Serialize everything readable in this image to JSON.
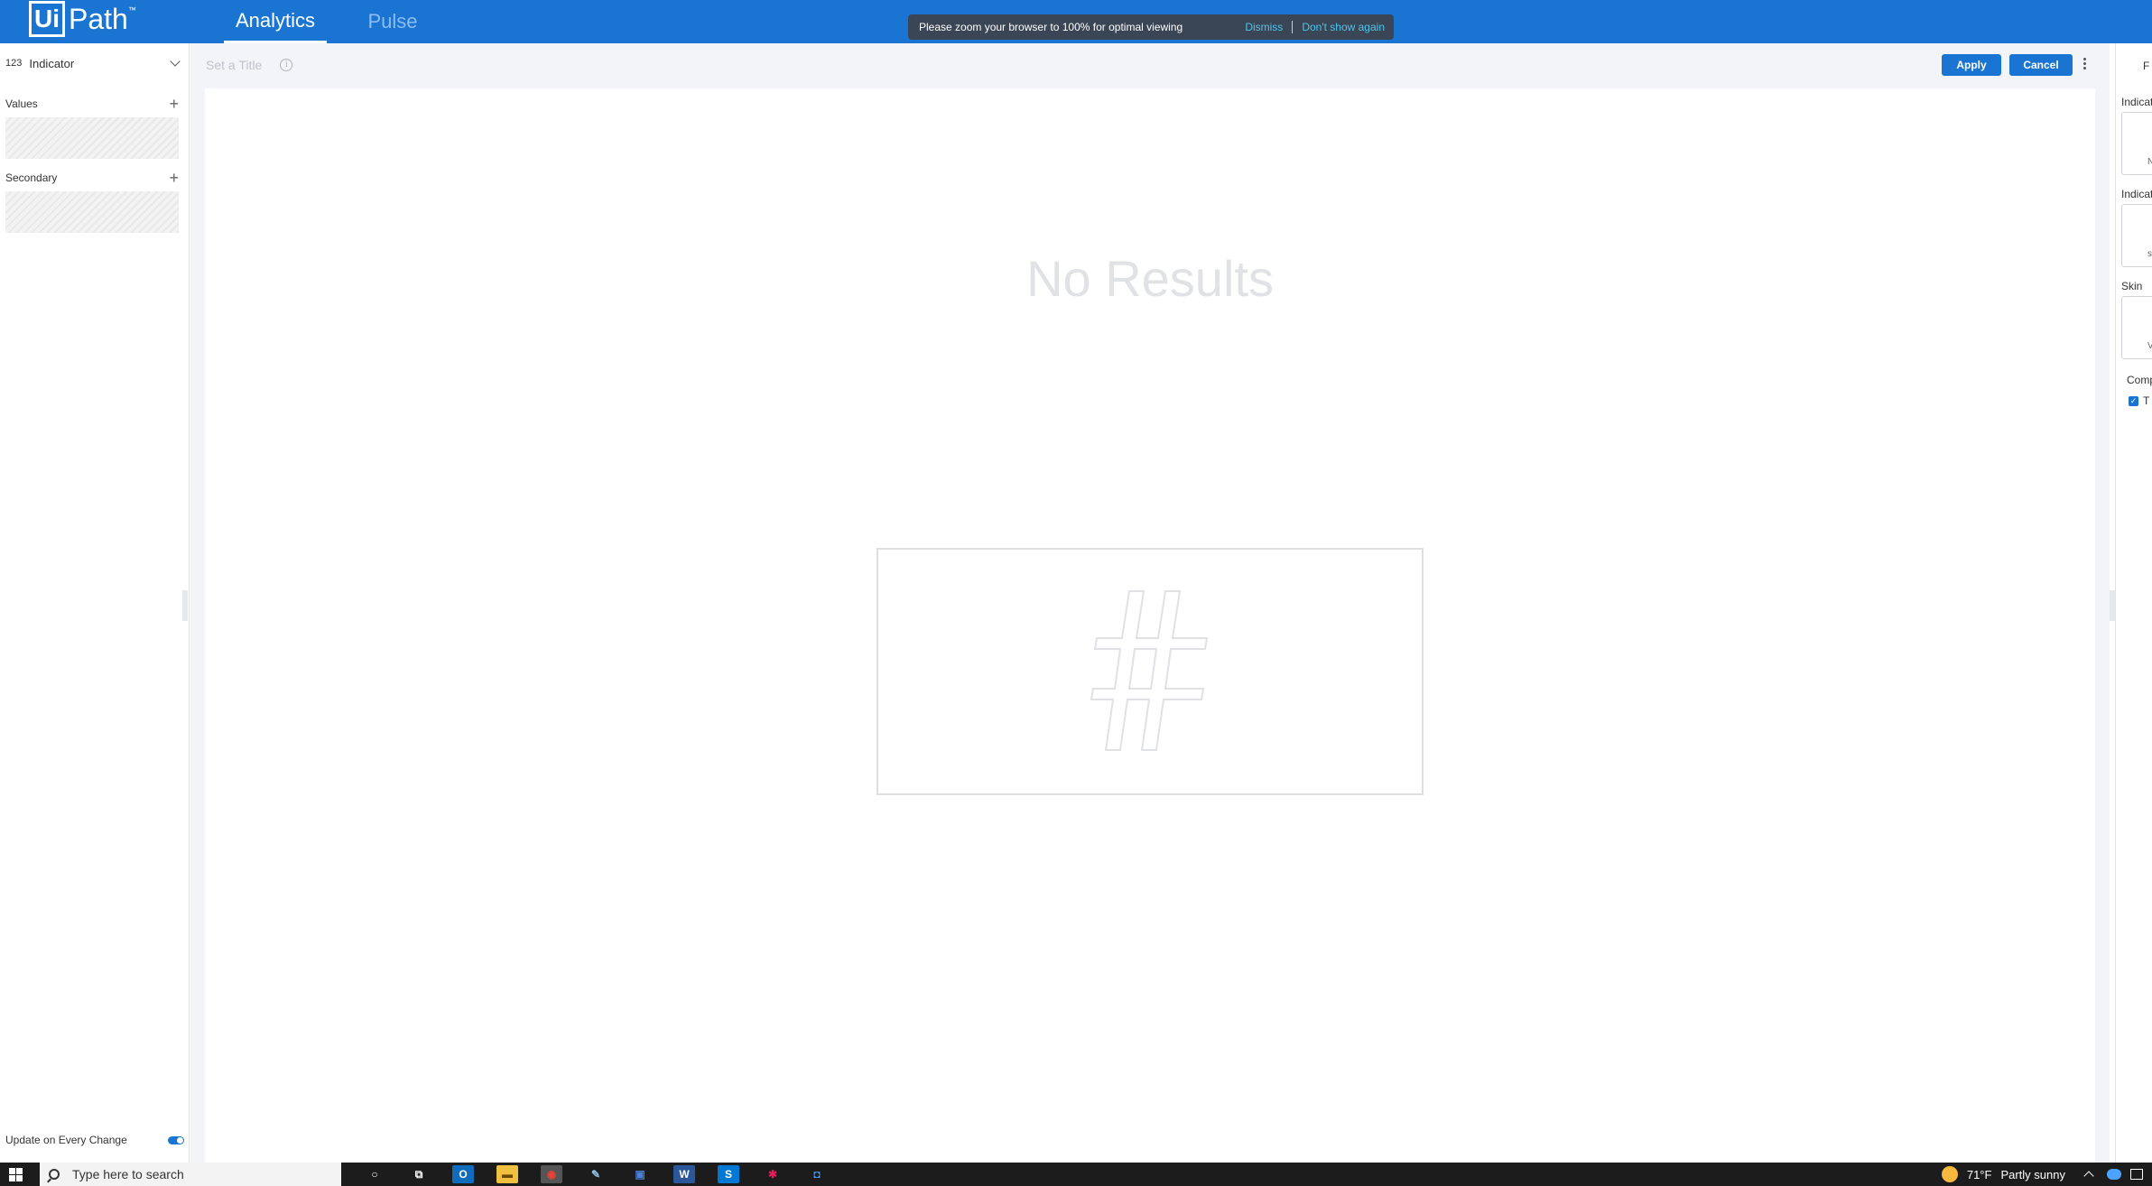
{
  "header": {
    "logo_mark": "Ui",
    "logo_text": "Path",
    "logo_tm": "™",
    "tabs": [
      {
        "label": "Analytics",
        "active": true
      },
      {
        "label": "Pulse",
        "active": false
      }
    ],
    "zoom_notice": {
      "message": "Please zoom your browser to 100% for optimal viewing",
      "dismiss": "Dismiss",
      "dont_show": "Don't show again"
    },
    "colors": {
      "bar": "#1a75d2",
      "accent": "#4fc3e9"
    }
  },
  "left_panel": {
    "viz_type_icon": "123",
    "viz_type": "Indicator",
    "sections": [
      {
        "title": "Values",
        "add_icon": "+"
      },
      {
        "title": "Secondary",
        "add_icon": "+"
      }
    ],
    "update_label": "Update on Every Change",
    "update_toggle_on": true
  },
  "toolbar": {
    "title_placeholder": "Set a Title",
    "info_icon": "i",
    "apply_label": "Apply",
    "cancel_label": "Cancel"
  },
  "canvas": {
    "no_results": "No Results",
    "placeholder_icon": "hash-icon"
  },
  "right_panel": {
    "top_label": "F",
    "labels": [
      "Indicat",
      "Indicat",
      "Skin",
      "Comp"
    ],
    "box_values": [
      "N",
      "s",
      "V"
    ],
    "checkbox_label": "T",
    "checkbox_checked": true
  },
  "taskbar": {
    "search_placeholder": "Type here to search",
    "weather_temp": "71°F",
    "weather_text": "Partly sunny",
    "apps": [
      {
        "name": "cortana-icon",
        "glyph": "○"
      },
      {
        "name": "task-view-icon",
        "glyph": "⧉"
      },
      {
        "name": "outlook-icon",
        "glyph": "O"
      },
      {
        "name": "file-explorer-icon",
        "glyph": "▬"
      },
      {
        "name": "chrome-icon",
        "glyph": "◉"
      },
      {
        "name": "notepad-icon",
        "glyph": "✎"
      },
      {
        "name": "remote-desktop-icon",
        "glyph": "▣"
      },
      {
        "name": "word-icon",
        "glyph": "W"
      },
      {
        "name": "sharepoint-icon",
        "glyph": "S"
      },
      {
        "name": "slack-icon",
        "glyph": "✱"
      },
      {
        "name": "uipath-assistant-icon",
        "glyph": "◘"
      }
    ]
  }
}
